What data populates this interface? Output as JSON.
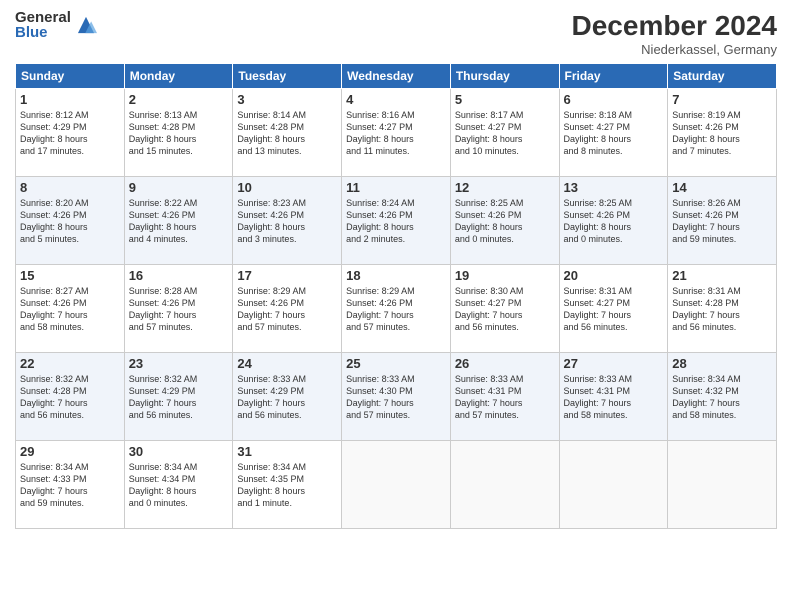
{
  "logo": {
    "general": "General",
    "blue": "Blue"
  },
  "header": {
    "month": "December 2024",
    "location": "Niederkassel, Germany"
  },
  "weekdays": [
    "Sunday",
    "Monday",
    "Tuesday",
    "Wednesday",
    "Thursday",
    "Friday",
    "Saturday"
  ],
  "weeks": [
    [
      {
        "day": "1",
        "info": "Sunrise: 8:12 AM\nSunset: 4:29 PM\nDaylight: 8 hours\nand 17 minutes."
      },
      {
        "day": "2",
        "info": "Sunrise: 8:13 AM\nSunset: 4:28 PM\nDaylight: 8 hours\nand 15 minutes."
      },
      {
        "day": "3",
        "info": "Sunrise: 8:14 AM\nSunset: 4:28 PM\nDaylight: 8 hours\nand 13 minutes."
      },
      {
        "day": "4",
        "info": "Sunrise: 8:16 AM\nSunset: 4:27 PM\nDaylight: 8 hours\nand 11 minutes."
      },
      {
        "day": "5",
        "info": "Sunrise: 8:17 AM\nSunset: 4:27 PM\nDaylight: 8 hours\nand 10 minutes."
      },
      {
        "day": "6",
        "info": "Sunrise: 8:18 AM\nSunset: 4:27 PM\nDaylight: 8 hours\nand 8 minutes."
      },
      {
        "day": "7",
        "info": "Sunrise: 8:19 AM\nSunset: 4:26 PM\nDaylight: 8 hours\nand 7 minutes."
      }
    ],
    [
      {
        "day": "8",
        "info": "Sunrise: 8:20 AM\nSunset: 4:26 PM\nDaylight: 8 hours\nand 5 minutes."
      },
      {
        "day": "9",
        "info": "Sunrise: 8:22 AM\nSunset: 4:26 PM\nDaylight: 8 hours\nand 4 minutes."
      },
      {
        "day": "10",
        "info": "Sunrise: 8:23 AM\nSunset: 4:26 PM\nDaylight: 8 hours\nand 3 minutes."
      },
      {
        "day": "11",
        "info": "Sunrise: 8:24 AM\nSunset: 4:26 PM\nDaylight: 8 hours\nand 2 minutes."
      },
      {
        "day": "12",
        "info": "Sunrise: 8:25 AM\nSunset: 4:26 PM\nDaylight: 8 hours\nand 0 minutes."
      },
      {
        "day": "13",
        "info": "Sunrise: 8:25 AM\nSunset: 4:26 PM\nDaylight: 8 hours\nand 0 minutes."
      },
      {
        "day": "14",
        "info": "Sunrise: 8:26 AM\nSunset: 4:26 PM\nDaylight: 7 hours\nand 59 minutes."
      }
    ],
    [
      {
        "day": "15",
        "info": "Sunrise: 8:27 AM\nSunset: 4:26 PM\nDaylight: 7 hours\nand 58 minutes."
      },
      {
        "day": "16",
        "info": "Sunrise: 8:28 AM\nSunset: 4:26 PM\nDaylight: 7 hours\nand 57 minutes."
      },
      {
        "day": "17",
        "info": "Sunrise: 8:29 AM\nSunset: 4:26 PM\nDaylight: 7 hours\nand 57 minutes."
      },
      {
        "day": "18",
        "info": "Sunrise: 8:29 AM\nSunset: 4:26 PM\nDaylight: 7 hours\nand 57 minutes."
      },
      {
        "day": "19",
        "info": "Sunrise: 8:30 AM\nSunset: 4:27 PM\nDaylight: 7 hours\nand 56 minutes."
      },
      {
        "day": "20",
        "info": "Sunrise: 8:31 AM\nSunset: 4:27 PM\nDaylight: 7 hours\nand 56 minutes."
      },
      {
        "day": "21",
        "info": "Sunrise: 8:31 AM\nSunset: 4:28 PM\nDaylight: 7 hours\nand 56 minutes."
      }
    ],
    [
      {
        "day": "22",
        "info": "Sunrise: 8:32 AM\nSunset: 4:28 PM\nDaylight: 7 hours\nand 56 minutes."
      },
      {
        "day": "23",
        "info": "Sunrise: 8:32 AM\nSunset: 4:29 PM\nDaylight: 7 hours\nand 56 minutes."
      },
      {
        "day": "24",
        "info": "Sunrise: 8:33 AM\nSunset: 4:29 PM\nDaylight: 7 hours\nand 56 minutes."
      },
      {
        "day": "25",
        "info": "Sunrise: 8:33 AM\nSunset: 4:30 PM\nDaylight: 7 hours\nand 57 minutes."
      },
      {
        "day": "26",
        "info": "Sunrise: 8:33 AM\nSunset: 4:31 PM\nDaylight: 7 hours\nand 57 minutes."
      },
      {
        "day": "27",
        "info": "Sunrise: 8:33 AM\nSunset: 4:31 PM\nDaylight: 7 hours\nand 58 minutes."
      },
      {
        "day": "28",
        "info": "Sunrise: 8:34 AM\nSunset: 4:32 PM\nDaylight: 7 hours\nand 58 minutes."
      }
    ],
    [
      {
        "day": "29",
        "info": "Sunrise: 8:34 AM\nSunset: 4:33 PM\nDaylight: 7 hours\nand 59 minutes."
      },
      {
        "day": "30",
        "info": "Sunrise: 8:34 AM\nSunset: 4:34 PM\nDaylight: 8 hours\nand 0 minutes."
      },
      {
        "day": "31",
        "info": "Sunrise: 8:34 AM\nSunset: 4:35 PM\nDaylight: 8 hours\nand 1 minute."
      },
      null,
      null,
      null,
      null
    ]
  ]
}
